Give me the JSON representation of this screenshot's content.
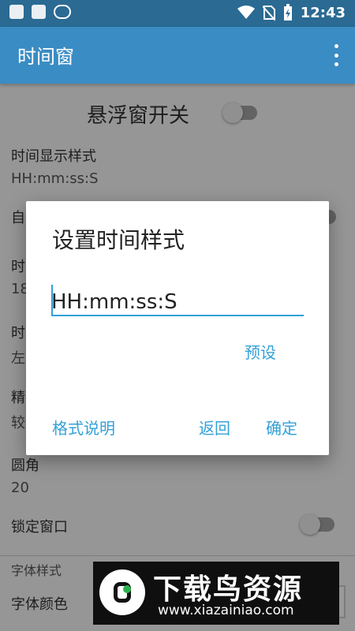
{
  "status": {
    "time": "12:43"
  },
  "appbar": {
    "title": "时间窗"
  },
  "settings": {
    "float_label": "悬浮窗开关",
    "display_style_label": "时间显示样式",
    "display_style_value": "HH:mm:ss:S",
    "row2_partial": "自",
    "row3_partial_label": "时",
    "row3_partial_value": "18",
    "row4_partial_label": "时",
    "row4_partial_value": "左",
    "row5_partial_label": "精",
    "row5_partial_value": "较",
    "corner_label": "圆角",
    "corner_value": "20",
    "lock_label": "锁定窗口",
    "font_section": "字体样式",
    "font_color_label": "字体颜色"
  },
  "dialog": {
    "title": "设置时间样式",
    "input_value": "HH:mm:ss:S",
    "preset_button": "预设",
    "format_button": "格式说明",
    "back_button": "返回",
    "ok_button": "确定"
  },
  "watermark": {
    "text": "下载鸟资源",
    "url": "www.xiazainiao.com"
  },
  "colors": {
    "statusbar": "#2a6a93",
    "appbar": "#3a8cc4",
    "accent": "#34a0d8"
  }
}
